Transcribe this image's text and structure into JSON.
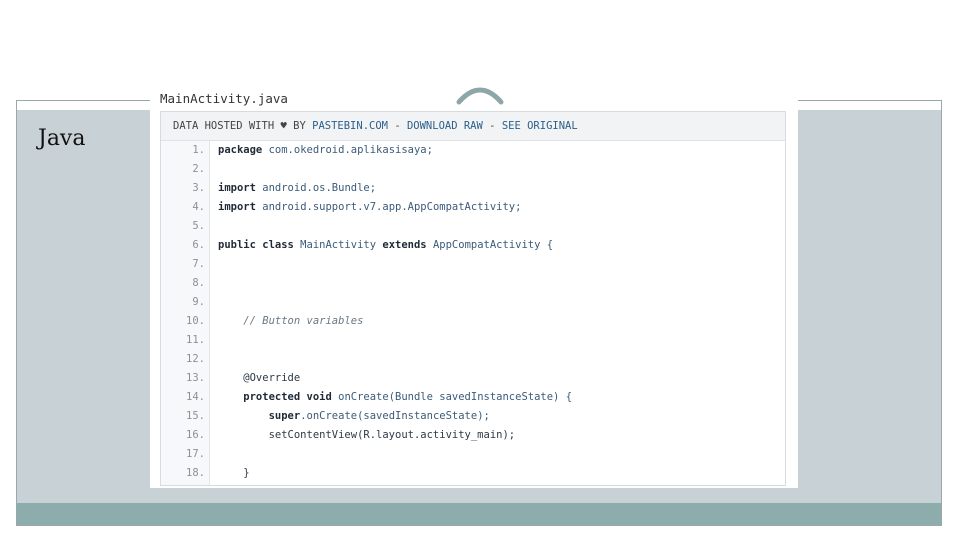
{
  "slide": {
    "title": "Java",
    "colors": {
      "body": "#c7d1d6",
      "footer": "#8dadad",
      "frame": "#9aa8ac"
    },
    "ornament_icon": "arc-ornament"
  },
  "file_name": "MainActivity.java",
  "paste_header": {
    "prefix": "DATA HOSTED WITH",
    "heart": "♥",
    "by": "BY",
    "site": "PASTEBIN.COM",
    "sep1": "-",
    "download": "DOWNLOAD RAW",
    "sep2": "-",
    "see_original": "SEE ORIGINAL"
  },
  "code": [
    {
      "n": "1.",
      "segments": [
        {
          "t": "package",
          "c": "kw"
        },
        {
          "t": " com.okedroid.aplikasisaya;",
          "c": "id"
        }
      ]
    },
    {
      "n": "2.",
      "segments": []
    },
    {
      "n": "3.",
      "segments": [
        {
          "t": "import",
          "c": "kw"
        },
        {
          "t": " android.os.Bundle;",
          "c": "id"
        }
      ]
    },
    {
      "n": "4.",
      "segments": [
        {
          "t": "import",
          "c": "kw"
        },
        {
          "t": " android.support.v7.app.AppCompatActivity;",
          "c": "id"
        }
      ]
    },
    {
      "n": "5.",
      "segments": []
    },
    {
      "n": "6.",
      "segments": [
        {
          "t": "public class",
          "c": "kw"
        },
        {
          "t": " MainActivity ",
          "c": "id"
        },
        {
          "t": "extends",
          "c": "kw"
        },
        {
          "t": " AppCompatActivity {",
          "c": "id"
        }
      ]
    },
    {
      "n": "7.",
      "segments": []
    },
    {
      "n": "8.",
      "segments": []
    },
    {
      "n": "9.",
      "segments": []
    },
    {
      "n": "10.",
      "segments": [
        {
          "t": "    // Button variables",
          "c": "cm"
        }
      ]
    },
    {
      "n": "11.",
      "segments": []
    },
    {
      "n": "12.",
      "segments": []
    },
    {
      "n": "13.",
      "segments": [
        {
          "t": "    @Override",
          "c": ""
        }
      ]
    },
    {
      "n": "14.",
      "segments": [
        {
          "t": "    protected void",
          "c": "kw"
        },
        {
          "t": " onCreate(Bundle savedInstanceState) {",
          "c": "id"
        }
      ]
    },
    {
      "n": "15.",
      "segments": [
        {
          "t": "        super",
          "c": "kw"
        },
        {
          "t": ".onCreate(savedInstanceState);",
          "c": "id"
        }
      ]
    },
    {
      "n": "16.",
      "segments": [
        {
          "t": "        setContentView(R.layout.activity_main);",
          "c": ""
        }
      ]
    },
    {
      "n": "17.",
      "segments": []
    },
    {
      "n": "18.",
      "segments": [
        {
          "t": "    }",
          "c": ""
        }
      ]
    }
  ]
}
